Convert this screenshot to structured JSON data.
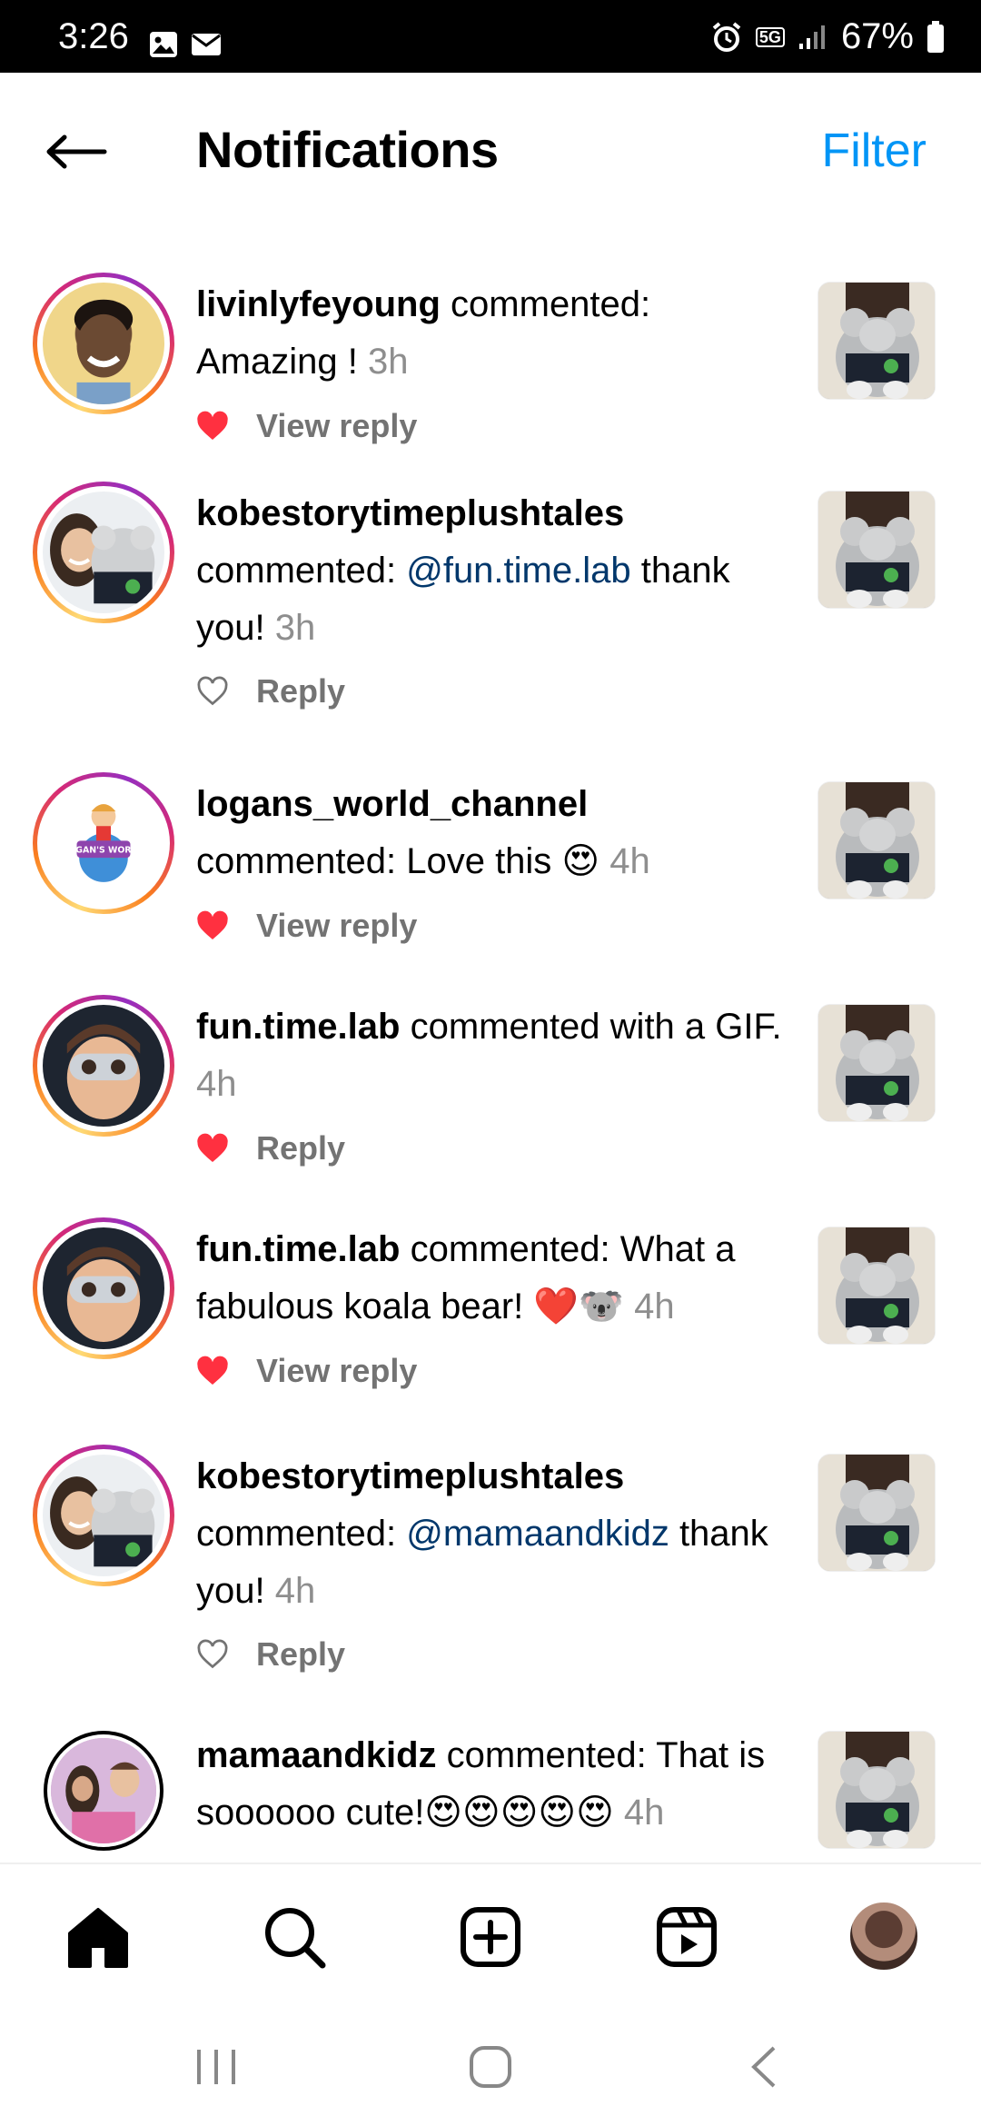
{
  "status_bar": {
    "time": "3:26",
    "battery": "67%",
    "network": "5G"
  },
  "header": {
    "title": "Notifications",
    "filter_label": "Filter"
  },
  "notifications": [
    {
      "username": "livinlyfeyoung",
      "text": " commented: Amazing ! ",
      "time": "3h",
      "liked": true,
      "action": "View reply"
    },
    {
      "username": "kobestorytimeplushtales",
      "pre": " commented: ",
      "mention": "@fun.time.lab",
      "post": " thank you! ",
      "time": "3h",
      "liked": false,
      "action": "Reply"
    },
    {
      "username": "logans_world_channel",
      "text": " commented: Love this 😍 ",
      "time": "4h",
      "liked": true,
      "action": "View reply"
    },
    {
      "username": "fun.time.lab",
      "text": " commented with a GIF. ",
      "time": "4h",
      "liked": true,
      "action": "Reply"
    },
    {
      "username": "fun.time.lab",
      "text": " commented: What a fabulous koala bear! ❤️🐨 ",
      "time": "4h",
      "liked": true,
      "action": "View reply"
    },
    {
      "username": "kobestorytimeplushtales",
      "pre": " commented: ",
      "mention": "@mamaandkidz",
      "post": " thank you! ",
      "time": "4h",
      "liked": false,
      "action": "Reply"
    },
    {
      "username": "mamaandkidz",
      "text": " commented: That is soooooo cute!😍😍😍😍😍 ",
      "time": "4h"
    }
  ],
  "logo_text": "LOGAN'S WORLD",
  "colors": {
    "accent": "#0095f6",
    "like": "#ff3040",
    "mention": "#00376b",
    "muted": "#8e8e8e"
  },
  "bottom_nav": [
    "home-icon",
    "search-icon",
    "create-icon",
    "reels-icon",
    "profile-avatar"
  ]
}
